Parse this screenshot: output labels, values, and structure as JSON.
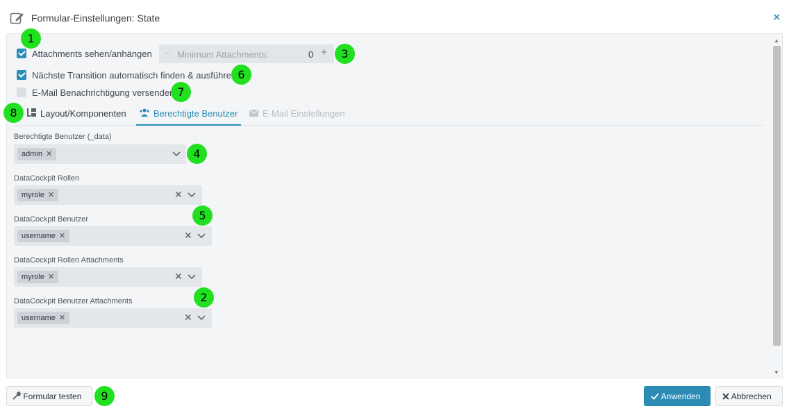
{
  "header": {
    "title": "Formular-Einstellungen: State",
    "edit_icon": "pencil-edit-icon",
    "close_label": "✕"
  },
  "options": {
    "attachments": {
      "label": "Attachments sehen/anhängen",
      "checked": true
    },
    "min_attachments": {
      "label": "Minimum Attachments:",
      "value": "0",
      "minus": "−",
      "plus": "+"
    },
    "auto_transition": {
      "label": "Nächste Transition automatisch finden & ausführen",
      "checked": true
    },
    "email_notify": {
      "label": "E-Mail Benachrichtigung versenden",
      "checked": false
    }
  },
  "tabs": [
    {
      "label": "Layout/Komponenten",
      "icon": "layout-icon",
      "state": "normal"
    },
    {
      "label": "Berechtigte Benutzer",
      "icon": "users-icon",
      "state": "active"
    },
    {
      "label": "E-Mail Einstellungen",
      "icon": "envelope-icon",
      "state": "disabled"
    }
  ],
  "fields": [
    {
      "label": "Berechtigte Benutzer (_data)",
      "chips": [
        "admin"
      ]
    },
    {
      "label": "DataCockpit Rollen",
      "chips": [
        "myrole"
      ]
    },
    {
      "label": "DataCockpit Benutzer",
      "chips": [
        "username"
      ]
    },
    {
      "label": "DataCockpit Rollen Attachments",
      "chips": [
        "myrole"
      ]
    },
    {
      "label": "DataCockpit Benutzer Attachments",
      "chips": [
        "username"
      ]
    }
  ],
  "symbols": {
    "chip_remove": "✕",
    "clear": "✕"
  },
  "badges": [
    "1",
    "3",
    "6",
    "7",
    "8",
    "4",
    "5",
    "2",
    "9"
  ],
  "footer": {
    "test_button": "Formular testen",
    "apply_button": "Anwenden",
    "cancel_button": "Abbrechen"
  },
  "colors": {
    "accent": "#2b8cb5",
    "badge": "#20e020",
    "panel_bg": "#f3f5f7"
  }
}
